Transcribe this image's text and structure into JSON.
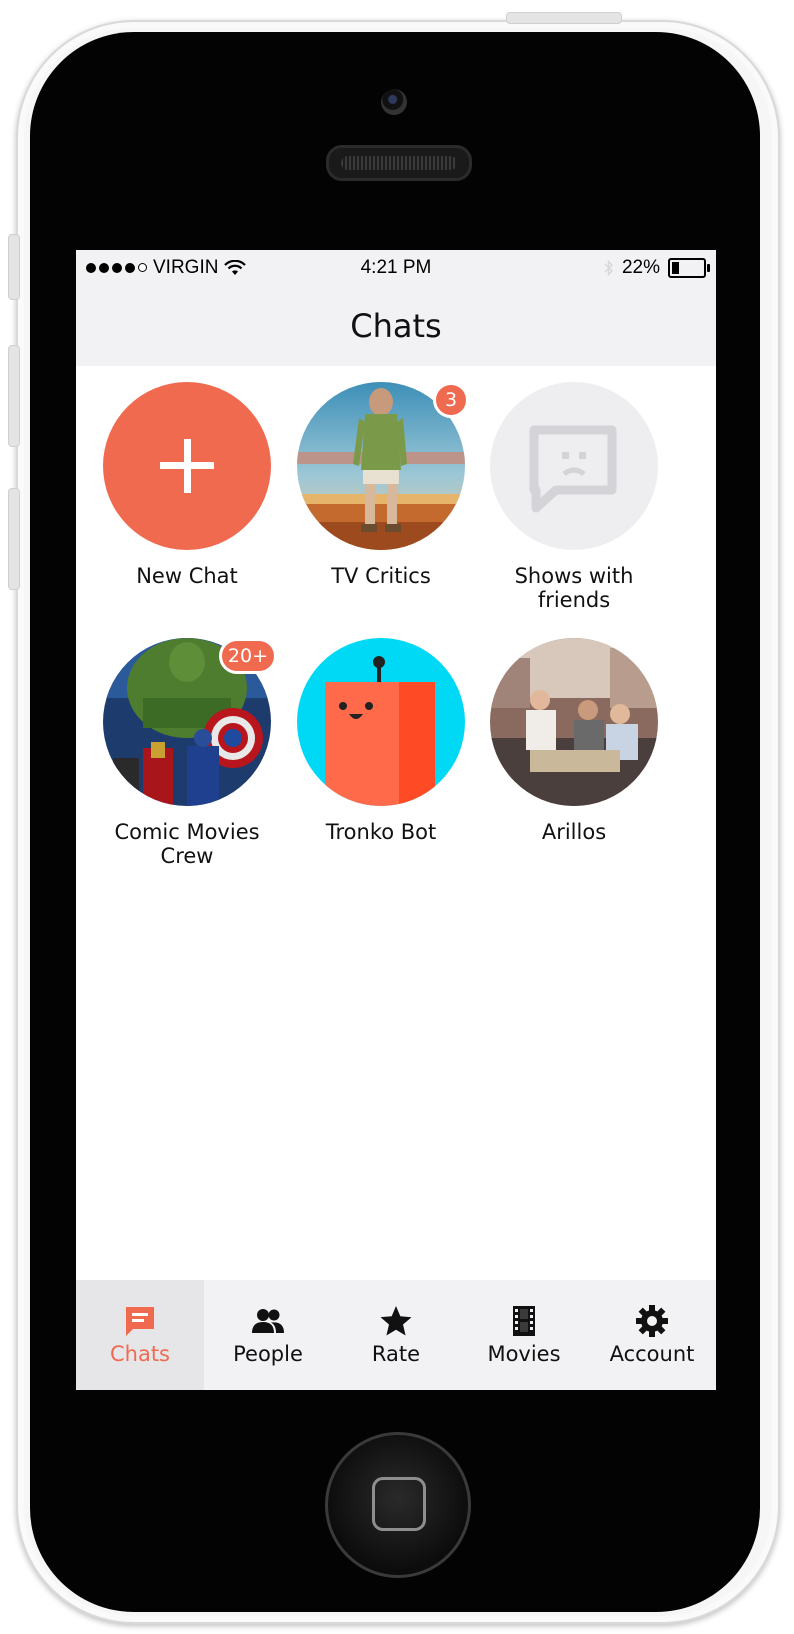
{
  "status_bar": {
    "carrier": "VIRGIN",
    "time": "4:21 PM",
    "battery_percent_text": "22%",
    "battery_level": 0.22,
    "signal_bars_filled": 4,
    "signal_bars_total": 5
  },
  "nav": {
    "title": "Chats"
  },
  "chats": [
    {
      "label": "New Chat",
      "avatar": "plus-icon",
      "badge": ""
    },
    {
      "label": "TV Critics",
      "avatar": "photo-man-desert",
      "badge": "3"
    },
    {
      "label": "Shows with friends",
      "avatar": "chat-sad-face-icon",
      "badge": ""
    },
    {
      "label": "Comic Movies Crew",
      "avatar": "photo-superheroes",
      "badge": "20+"
    },
    {
      "label": "Tronko Bot",
      "avatar": "robot-icon",
      "badge": ""
    },
    {
      "label": "Arillos",
      "avatar": "photo-friends-group",
      "badge": ""
    }
  ],
  "tabs": [
    {
      "label": "Chats",
      "icon": "chat-bubble-icon",
      "active": true
    },
    {
      "label": "People",
      "icon": "people-icon",
      "active": false
    },
    {
      "label": "Rate",
      "icon": "star-icon",
      "active": false
    },
    {
      "label": "Movies",
      "icon": "film-icon",
      "active": false
    },
    {
      "label": "Account",
      "icon": "gear-icon",
      "active": false
    }
  ],
  "colors": {
    "accent": "#f06a50",
    "bar_background": "#f2f2f4",
    "robot_background": "#00d9f5",
    "placeholder_background": "#eeeef0"
  }
}
